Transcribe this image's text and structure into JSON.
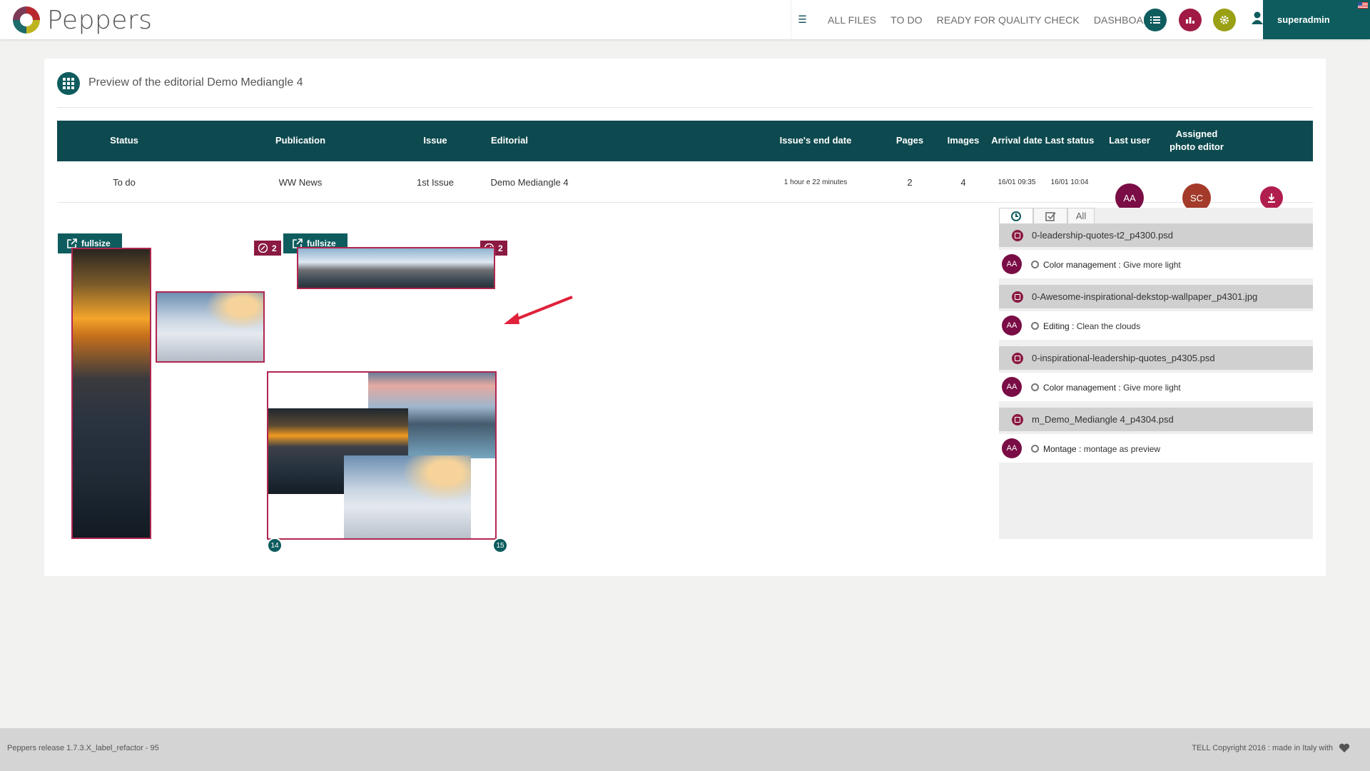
{
  "app": {
    "brand": "Peppers"
  },
  "nav": {
    "items": [
      "ALL FILES",
      "TO DO",
      "READY FOR QUALITY CHECK",
      "DASHBOARD"
    ]
  },
  "user": {
    "name": "superadmin"
  },
  "page": {
    "title": "Preview of the editorial Demo Mediangle 4"
  },
  "table": {
    "headers": {
      "status": "Status",
      "publication": "Publication",
      "issue": "Issue",
      "editorial": "Editorial",
      "end_date": "Issue's end date",
      "pages": "Pages",
      "images": "Images",
      "arrival": "Arrival date",
      "last_status": "Last status",
      "last_user": "Last user",
      "photo_editor_1": "Assigned",
      "photo_editor_2": "photo editor"
    },
    "row": {
      "status": "To do",
      "publication": "WW News",
      "issue": "1st Issue",
      "editorial": "Demo Mediangle 4",
      "end_date": "1 hour e 22 minutes",
      "pages": "2",
      "images": "4",
      "arrival": "16/01 09:35",
      "last_status": "16/01 10:04",
      "last_user": "AA",
      "photo_editor": "SC"
    }
  },
  "preview": {
    "fullsize_label": "fullsize",
    "badge_count_1": "2",
    "badge_count_2": "2",
    "page_left": "14",
    "page_right": "15"
  },
  "panel": {
    "tab_all": "All",
    "files": [
      {
        "name": "0-leadership-quotes-t2_p4300.psd",
        "user": "AA",
        "task_type": "Color management :",
        "task_text": " Give more light"
      },
      {
        "name": "0-Awesome-inspirational-dekstop-wallpaper_p4301.jpg",
        "user": "AA",
        "task_type": "Editing :",
        "task_text": " Clean the clouds"
      },
      {
        "name": "0-inspirational-leadership-quotes_p4305.psd",
        "user": "AA",
        "task_type": "Color management :",
        "task_text": " Give more light"
      },
      {
        "name": "m_Demo_Mediangle 4_p4304.psd",
        "user": "AA",
        "task_type": "Montage :",
        "task_text": " montage as preview"
      }
    ]
  },
  "footer": {
    "release": "Peppers release 1.7.3.X_label_refactor - 95",
    "copyright": "TELL Copyright 2016 : made in Italy with"
  },
  "colors": {
    "teal": "#0e5c5e",
    "dark_teal": "#0d4a4f",
    "crimson": "#b01e4e",
    "plum": "#7a0d45",
    "olive": "#9aa014",
    "rust": "#a33a2a"
  }
}
